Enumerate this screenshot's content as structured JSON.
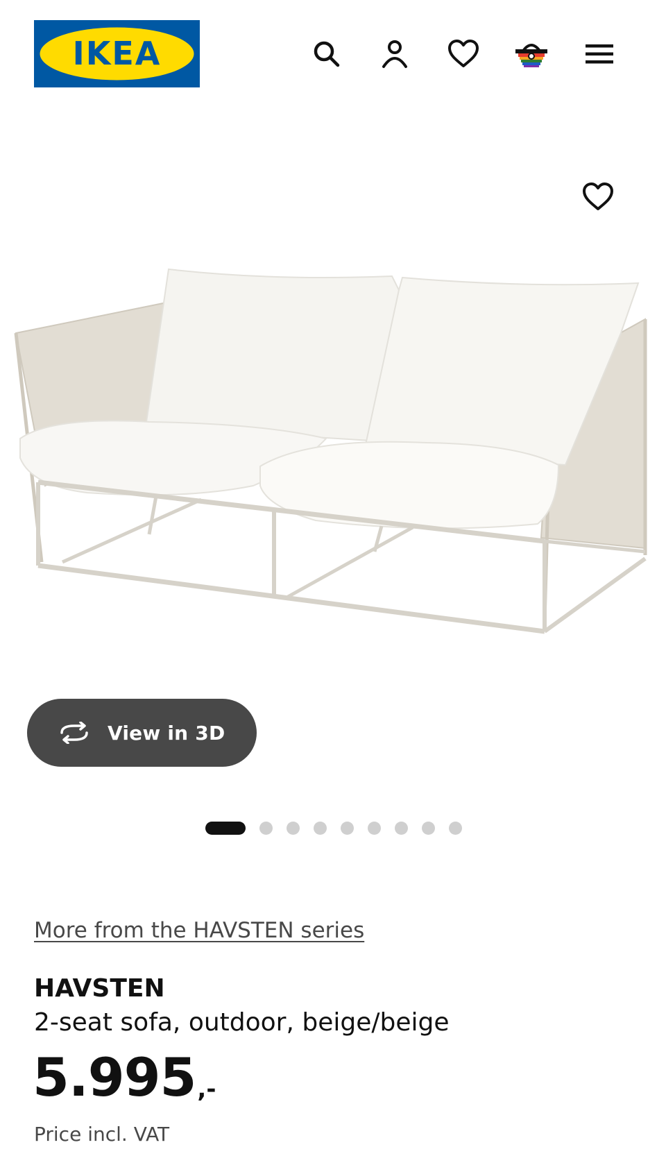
{
  "header": {
    "logo_text": "IKEA",
    "icons": {
      "search": "search-icon",
      "account": "user-icon",
      "wishlist": "heart-icon",
      "cart": "shopping-basket-icon",
      "menu": "hamburger-menu-icon"
    }
  },
  "colors": {
    "brand_blue": "#0058a3",
    "brand_yellow": "#ffdb00",
    "button_dark": "#484848",
    "text_primary": "#111111",
    "text_secondary": "#484848",
    "dot_inactive": "#cfcfcf"
  },
  "gallery": {
    "view_3d_label": "View in 3D",
    "total_images": 9,
    "active_index": 0
  },
  "product": {
    "series_link": "More from the HAVSTEN series",
    "name": "HAVSTEN",
    "description": "2-seat sofa, outdoor, beige/beige",
    "price_main": "5.995",
    "price_suffix": ",-",
    "price_note": "Price incl. VAT"
  }
}
